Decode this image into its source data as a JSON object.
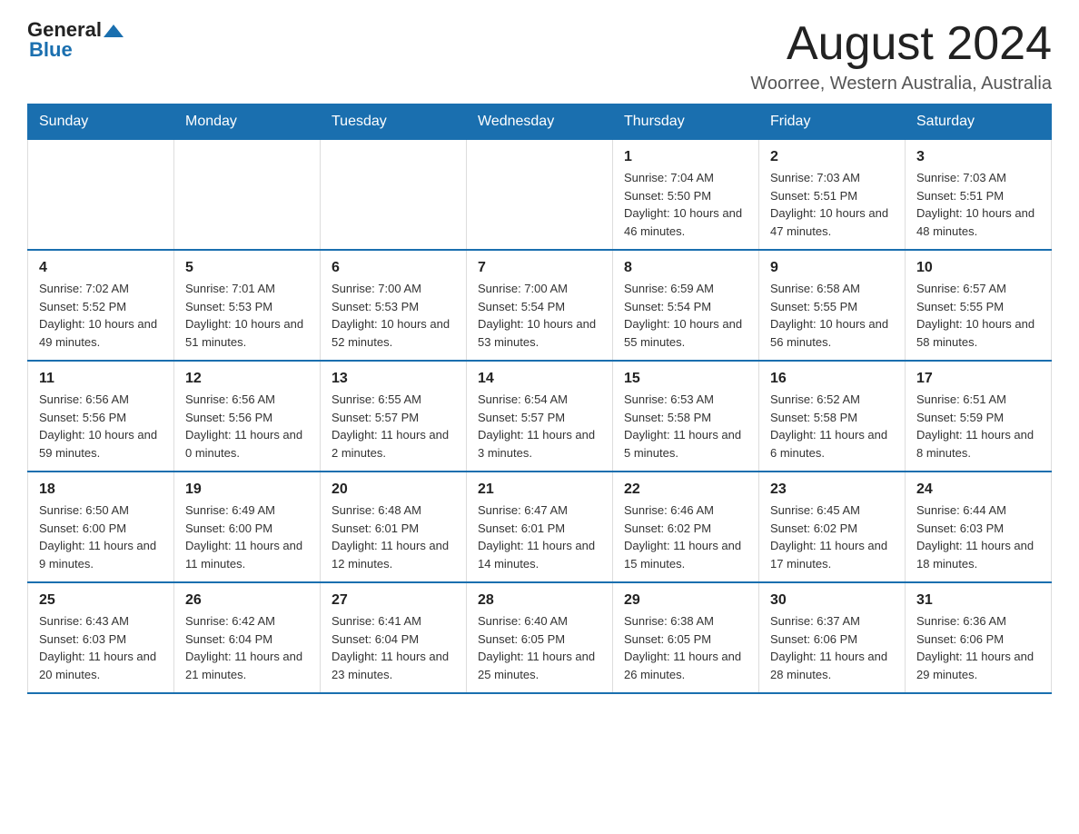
{
  "header": {
    "logo_general": "General",
    "logo_blue": "Blue",
    "month_title": "August 2024",
    "location": "Woorree, Western Australia, Australia"
  },
  "days_of_week": [
    "Sunday",
    "Monday",
    "Tuesday",
    "Wednesday",
    "Thursday",
    "Friday",
    "Saturday"
  ],
  "weeks": [
    [
      {
        "day": "",
        "sunrise": "",
        "sunset": "",
        "daylight": ""
      },
      {
        "day": "",
        "sunrise": "",
        "sunset": "",
        "daylight": ""
      },
      {
        "day": "",
        "sunrise": "",
        "sunset": "",
        "daylight": ""
      },
      {
        "day": "",
        "sunrise": "",
        "sunset": "",
        "daylight": ""
      },
      {
        "day": "1",
        "sunrise": "Sunrise: 7:04 AM",
        "sunset": "Sunset: 5:50 PM",
        "daylight": "Daylight: 10 hours and 46 minutes."
      },
      {
        "day": "2",
        "sunrise": "Sunrise: 7:03 AM",
        "sunset": "Sunset: 5:51 PM",
        "daylight": "Daylight: 10 hours and 47 minutes."
      },
      {
        "day": "3",
        "sunrise": "Sunrise: 7:03 AM",
        "sunset": "Sunset: 5:51 PM",
        "daylight": "Daylight: 10 hours and 48 minutes."
      }
    ],
    [
      {
        "day": "4",
        "sunrise": "Sunrise: 7:02 AM",
        "sunset": "Sunset: 5:52 PM",
        "daylight": "Daylight: 10 hours and 49 minutes."
      },
      {
        "day": "5",
        "sunrise": "Sunrise: 7:01 AM",
        "sunset": "Sunset: 5:53 PM",
        "daylight": "Daylight: 10 hours and 51 minutes."
      },
      {
        "day": "6",
        "sunrise": "Sunrise: 7:00 AM",
        "sunset": "Sunset: 5:53 PM",
        "daylight": "Daylight: 10 hours and 52 minutes."
      },
      {
        "day": "7",
        "sunrise": "Sunrise: 7:00 AM",
        "sunset": "Sunset: 5:54 PM",
        "daylight": "Daylight: 10 hours and 53 minutes."
      },
      {
        "day": "8",
        "sunrise": "Sunrise: 6:59 AM",
        "sunset": "Sunset: 5:54 PM",
        "daylight": "Daylight: 10 hours and 55 minutes."
      },
      {
        "day": "9",
        "sunrise": "Sunrise: 6:58 AM",
        "sunset": "Sunset: 5:55 PM",
        "daylight": "Daylight: 10 hours and 56 minutes."
      },
      {
        "day": "10",
        "sunrise": "Sunrise: 6:57 AM",
        "sunset": "Sunset: 5:55 PM",
        "daylight": "Daylight: 10 hours and 58 minutes."
      }
    ],
    [
      {
        "day": "11",
        "sunrise": "Sunrise: 6:56 AM",
        "sunset": "Sunset: 5:56 PM",
        "daylight": "Daylight: 10 hours and 59 minutes."
      },
      {
        "day": "12",
        "sunrise": "Sunrise: 6:56 AM",
        "sunset": "Sunset: 5:56 PM",
        "daylight": "Daylight: 11 hours and 0 minutes."
      },
      {
        "day": "13",
        "sunrise": "Sunrise: 6:55 AM",
        "sunset": "Sunset: 5:57 PM",
        "daylight": "Daylight: 11 hours and 2 minutes."
      },
      {
        "day": "14",
        "sunrise": "Sunrise: 6:54 AM",
        "sunset": "Sunset: 5:57 PM",
        "daylight": "Daylight: 11 hours and 3 minutes."
      },
      {
        "day": "15",
        "sunrise": "Sunrise: 6:53 AM",
        "sunset": "Sunset: 5:58 PM",
        "daylight": "Daylight: 11 hours and 5 minutes."
      },
      {
        "day": "16",
        "sunrise": "Sunrise: 6:52 AM",
        "sunset": "Sunset: 5:58 PM",
        "daylight": "Daylight: 11 hours and 6 minutes."
      },
      {
        "day": "17",
        "sunrise": "Sunrise: 6:51 AM",
        "sunset": "Sunset: 5:59 PM",
        "daylight": "Daylight: 11 hours and 8 minutes."
      }
    ],
    [
      {
        "day": "18",
        "sunrise": "Sunrise: 6:50 AM",
        "sunset": "Sunset: 6:00 PM",
        "daylight": "Daylight: 11 hours and 9 minutes."
      },
      {
        "day": "19",
        "sunrise": "Sunrise: 6:49 AM",
        "sunset": "Sunset: 6:00 PM",
        "daylight": "Daylight: 11 hours and 11 minutes."
      },
      {
        "day": "20",
        "sunrise": "Sunrise: 6:48 AM",
        "sunset": "Sunset: 6:01 PM",
        "daylight": "Daylight: 11 hours and 12 minutes."
      },
      {
        "day": "21",
        "sunrise": "Sunrise: 6:47 AM",
        "sunset": "Sunset: 6:01 PM",
        "daylight": "Daylight: 11 hours and 14 minutes."
      },
      {
        "day": "22",
        "sunrise": "Sunrise: 6:46 AM",
        "sunset": "Sunset: 6:02 PM",
        "daylight": "Daylight: 11 hours and 15 minutes."
      },
      {
        "day": "23",
        "sunrise": "Sunrise: 6:45 AM",
        "sunset": "Sunset: 6:02 PM",
        "daylight": "Daylight: 11 hours and 17 minutes."
      },
      {
        "day": "24",
        "sunrise": "Sunrise: 6:44 AM",
        "sunset": "Sunset: 6:03 PM",
        "daylight": "Daylight: 11 hours and 18 minutes."
      }
    ],
    [
      {
        "day": "25",
        "sunrise": "Sunrise: 6:43 AM",
        "sunset": "Sunset: 6:03 PM",
        "daylight": "Daylight: 11 hours and 20 minutes."
      },
      {
        "day": "26",
        "sunrise": "Sunrise: 6:42 AM",
        "sunset": "Sunset: 6:04 PM",
        "daylight": "Daylight: 11 hours and 21 minutes."
      },
      {
        "day": "27",
        "sunrise": "Sunrise: 6:41 AM",
        "sunset": "Sunset: 6:04 PM",
        "daylight": "Daylight: 11 hours and 23 minutes."
      },
      {
        "day": "28",
        "sunrise": "Sunrise: 6:40 AM",
        "sunset": "Sunset: 6:05 PM",
        "daylight": "Daylight: 11 hours and 25 minutes."
      },
      {
        "day": "29",
        "sunrise": "Sunrise: 6:38 AM",
        "sunset": "Sunset: 6:05 PM",
        "daylight": "Daylight: 11 hours and 26 minutes."
      },
      {
        "day": "30",
        "sunrise": "Sunrise: 6:37 AM",
        "sunset": "Sunset: 6:06 PM",
        "daylight": "Daylight: 11 hours and 28 minutes."
      },
      {
        "day": "31",
        "sunrise": "Sunrise: 6:36 AM",
        "sunset": "Sunset: 6:06 PM",
        "daylight": "Daylight: 11 hours and 29 minutes."
      }
    ]
  ]
}
